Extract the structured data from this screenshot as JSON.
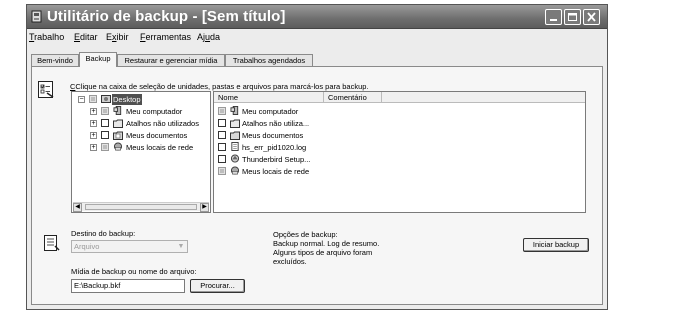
{
  "window": {
    "title": "Utilitário de backup - [Sem título]"
  },
  "menu": [
    "Trabalho",
    "Editar",
    "Exibir",
    "Ferramentas",
    "Ajuda"
  ],
  "menu_underline": [
    "T",
    "E",
    "x",
    "F",
    "u"
  ],
  "tabs": {
    "welcome": "Bem-vindo",
    "backup": "Backup",
    "restore": "Restaurar e gerenciar mídia",
    "scheduled": "Trabalhos agendados",
    "active": "Backup"
  },
  "instructions": "Clique na caixa de seleção de unidades, pastas e arquivos para marcá-los para backup.",
  "tree": {
    "root": "Desktop",
    "items": [
      "Meu computador",
      "Atalhos não utilizados",
      "Meus documentos",
      "Meus locais de rede"
    ]
  },
  "list": {
    "columns": [
      "Nome",
      "Comentário"
    ],
    "items": [
      "Meu computador",
      "Atalhos não utiliza...",
      "Meus documentos",
      "hs_err_pid1020.log",
      "Thunderbird Setup...",
      "Meus locais de rede"
    ]
  },
  "destination": {
    "label": "Destino do backup:",
    "value": "Arquivo"
  },
  "media": {
    "label": "Mídia de backup ou nome do arquivo:",
    "value": "E:\\Backup.bkf",
    "browse_label": "Procurar..."
  },
  "options": {
    "title": "Opções de backup:",
    "line1": "Backup normal.  Log de resumo.",
    "line2": "Alguns tipos de arquivo foram",
    "line3": "excluídos."
  },
  "start_button": "Iniciar backup"
}
